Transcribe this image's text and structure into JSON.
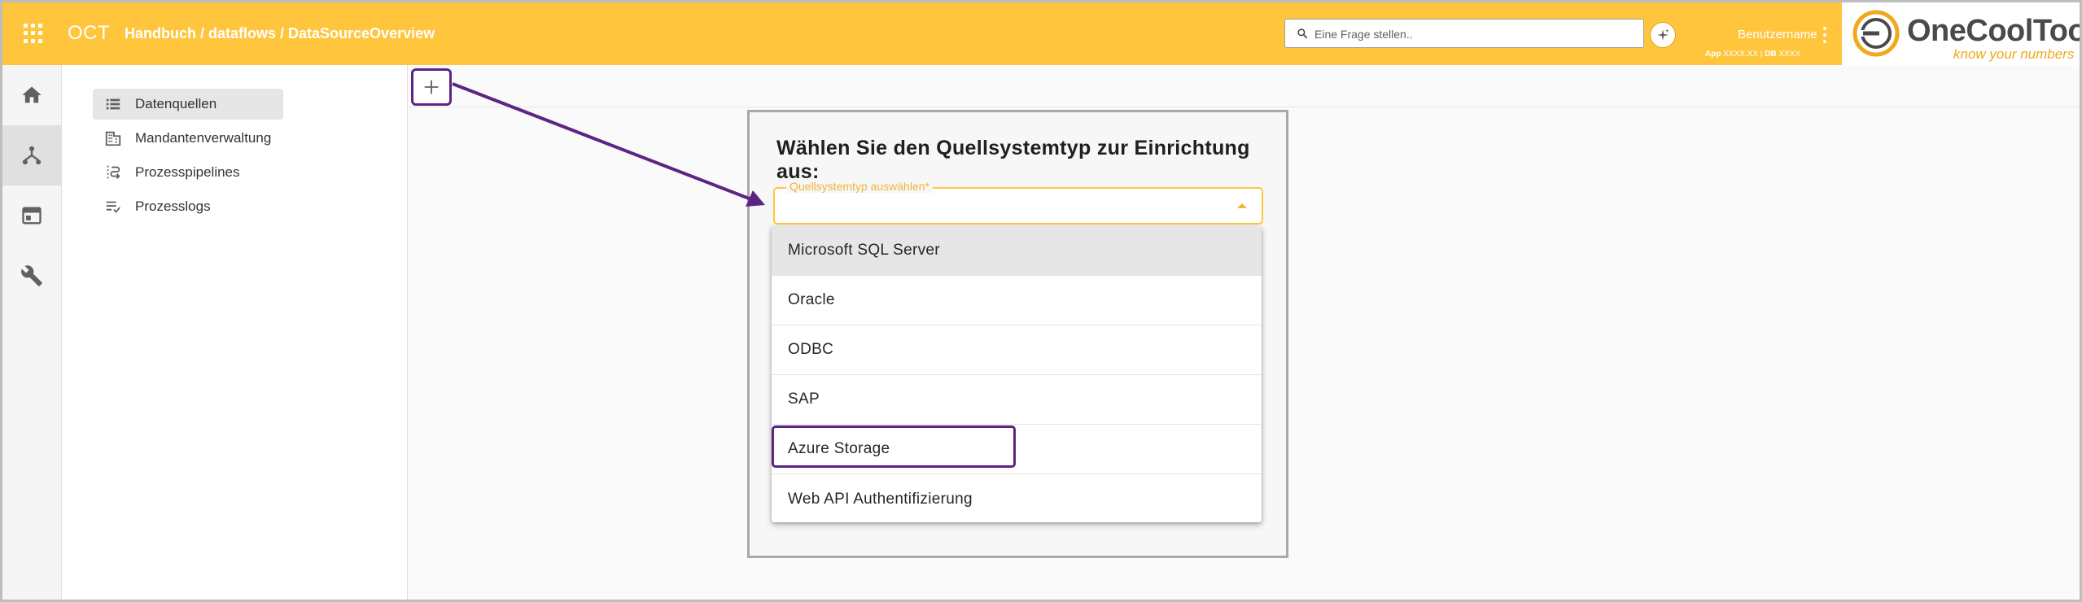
{
  "topbar": {
    "app_name": "OCT",
    "breadcrumb": "Handbuch / dataflows / DataSourceOverview",
    "search_placeholder": "Eine Frage stellen..",
    "user_name": "Benutzername",
    "version_app_label": "App",
    "version_app_value": "XXXX.XX",
    "version_separator": "|",
    "version_db_label": "DB",
    "version_db_value": "XXXX"
  },
  "logo": {
    "name": "OneCoolTool",
    "tagline": "know your numbers"
  },
  "rail": {
    "items": [
      {
        "icon": "home-icon",
        "active": false
      },
      {
        "icon": "dataflow-icon",
        "active": true
      },
      {
        "icon": "window-icon",
        "active": false
      },
      {
        "icon": "wrench-icon",
        "active": false
      }
    ]
  },
  "sidenav": {
    "items": [
      {
        "label": "Datenquellen",
        "icon": "list-icon",
        "active": true
      },
      {
        "label": "Mandantenverwaltung",
        "icon": "building-icon",
        "active": false
      },
      {
        "label": "Prozesspipelines",
        "icon": "pipeline-icon",
        "active": false
      },
      {
        "label": "Prozesslogs",
        "icon": "checklist-icon",
        "active": false
      }
    ]
  },
  "dialog": {
    "title": "Wählen Sie den Quellsystemtyp zur Einrichtung aus:",
    "select_label": "Quellsystemtyp auswählen*",
    "options": [
      "Microsoft SQL Server",
      "Oracle",
      "ODBC",
      "SAP",
      "Azure Storage",
      "Web API Authentifizierung"
    ],
    "hovered_option": "Microsoft SQL Server",
    "annotated_option": "Azure Storage"
  },
  "colors": {
    "accent": "#ffc53d",
    "annotation": "#5c2483",
    "logo_accent": "#f0a81c"
  }
}
